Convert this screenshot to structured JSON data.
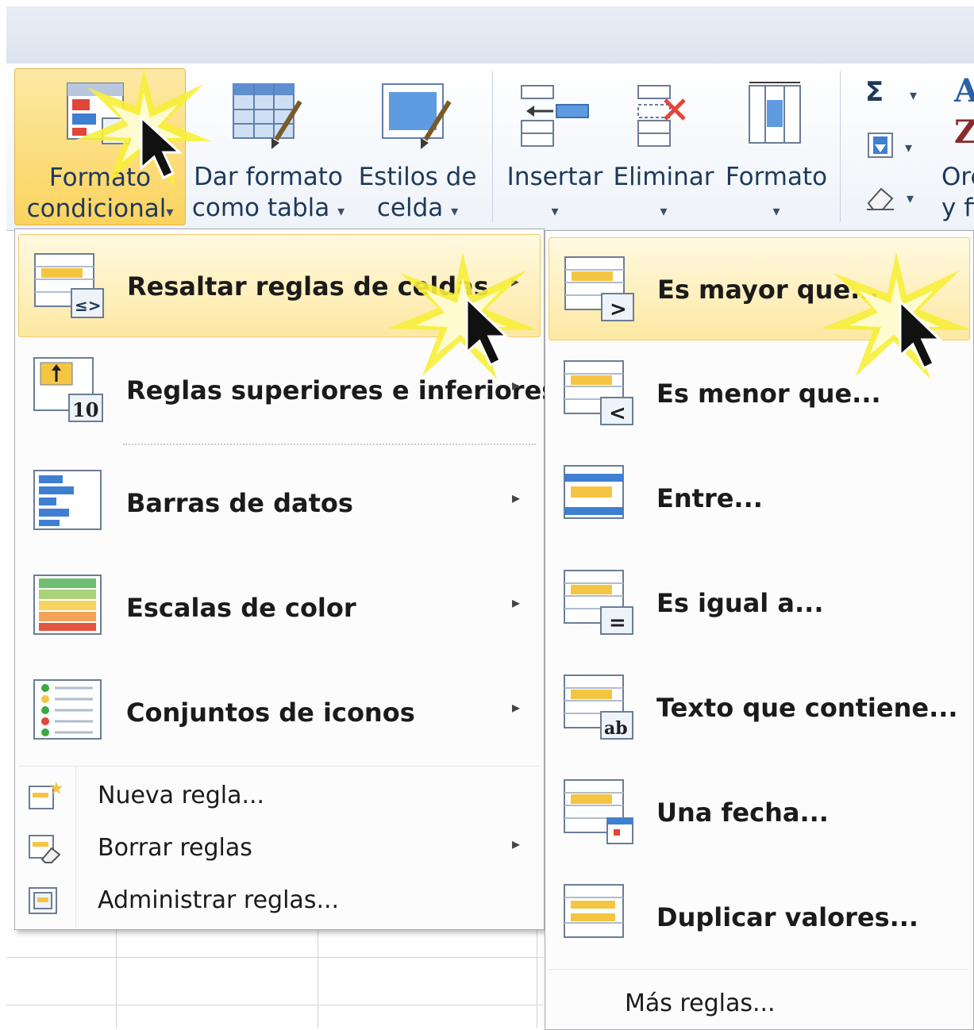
{
  "ribbon": {
    "buttons": [
      {
        "line1": "Formato",
        "line2": "condicional",
        "caret": "▾"
      },
      {
        "line1": "Dar formato",
        "line2": "como tabla",
        "caret": "▾"
      },
      {
        "line1": "Estilos de",
        "line2": "celda",
        "caret": "▾"
      },
      {
        "line1": "Insertar",
        "line2": "",
        "caret": "▾"
      },
      {
        "line1": "Eliminar",
        "line2": "",
        "caret": "▾"
      },
      {
        "line1": "Formato",
        "line2": "",
        "caret": "▾"
      }
    ],
    "editing": {
      "sigma": "Σ",
      "sort_partial_1": "Orc",
      "sort_partial_2": "y fil"
    }
  },
  "menu": {
    "items": [
      {
        "label": "Resaltar reglas de celdas",
        "has_submenu": true
      },
      {
        "label": "Reglas superiores e inferiores",
        "has_submenu": true
      },
      {
        "label": "Barras de datos",
        "has_submenu": true
      },
      {
        "label": "Escalas de color",
        "has_submenu": true
      },
      {
        "label": "Conjuntos de iconos",
        "has_submenu": true
      }
    ],
    "small_items": [
      {
        "label": "Nueva regla...",
        "has_submenu": false
      },
      {
        "label": "Borrar reglas",
        "has_submenu": true
      },
      {
        "label": "Administrar reglas...",
        "has_submenu": false
      }
    ],
    "submenu_arrow": "▸"
  },
  "submenu": {
    "items": [
      {
        "label": "Es mayor que...",
        "badge": ">"
      },
      {
        "label": "Es menor que...",
        "badge": "<"
      },
      {
        "label": "Entre...",
        "badge": ""
      },
      {
        "label": "Es igual a...",
        "badge": "="
      },
      {
        "label": "Texto que contiene...",
        "badge": "ab"
      },
      {
        "label": "Una fecha...",
        "badge": ""
      },
      {
        "label": "Duplicar valores...",
        "badge": ""
      }
    ],
    "more": "Más reglas..."
  },
  "icon_badges": {
    "top10": "10",
    "highlight": "≤>"
  },
  "colors": {
    "highlight": "#fde8a3",
    "ribbon_text": "#1e395b",
    "accent_blue": "#3f7fd1"
  }
}
